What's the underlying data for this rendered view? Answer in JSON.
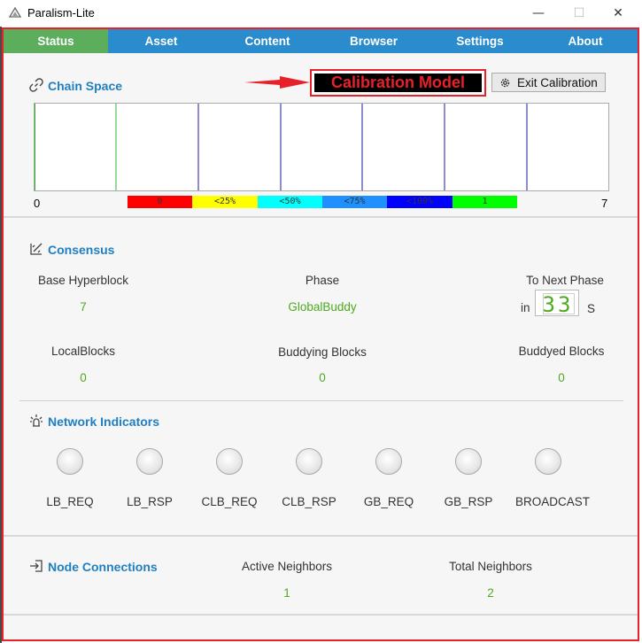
{
  "window": {
    "title": "Paralism-Lite"
  },
  "nav": {
    "tabs": [
      {
        "label": "Status",
        "active": true
      },
      {
        "label": "Asset",
        "active": false
      },
      {
        "label": "Content",
        "active": false
      },
      {
        "label": "Browser",
        "active": false
      },
      {
        "label": "Settings",
        "active": false
      },
      {
        "label": "About",
        "active": false
      }
    ]
  },
  "chain_space": {
    "title": "Chain Space",
    "calibration_label": "Calibration Model",
    "exit_button_label": "Exit Calibration",
    "axis_min": "0",
    "axis_max": "7",
    "legend": [
      {
        "label": "0",
        "color": "#ff0000"
      },
      {
        "label": "<25%",
        "color": "#ffff00"
      },
      {
        "label": "<50%",
        "color": "#00ffff"
      },
      {
        "label": "<75%",
        "color": "#1e90ff"
      },
      {
        "label": "<100%",
        "color": "#0000ff"
      },
      {
        "label": "1",
        "color": "#00ff00"
      }
    ]
  },
  "consensus": {
    "title": "Consensus",
    "base_hyperblock_label": "Base Hyperblock",
    "base_hyperblock_value": "7",
    "phase_label": "Phase",
    "phase_value": "GlobalBuddy",
    "next_phase_label": "To Next Phase",
    "next_phase_prefix": "in",
    "next_phase_value": "33",
    "next_phase_unit": "S",
    "local_blocks_label": "LocalBlocks",
    "local_blocks_value": "0",
    "buddying_blocks_label": "Buddying Blocks",
    "buddying_blocks_value": "0",
    "buddyed_blocks_label": "Buddyed Blocks",
    "buddyed_blocks_value": "0"
  },
  "network": {
    "title": "Network Indicators",
    "indicators": [
      "LB_REQ",
      "LB_RSP",
      "CLB_REQ",
      "CLB_RSP",
      "GB_REQ",
      "GB_RSP",
      "BROADCAST"
    ]
  },
  "node_connections": {
    "title": "Node Connections",
    "active_neighbors_label": "Active Neighbors",
    "active_neighbors_value": "1",
    "total_neighbors_label": "Total Neighbors",
    "total_neighbors_value": "2"
  },
  "colors": {
    "accent": "#2a8ccc",
    "active_tab": "#5cad5c",
    "value_green": "#4caa1e",
    "highlight_red": "#e8202a"
  }
}
